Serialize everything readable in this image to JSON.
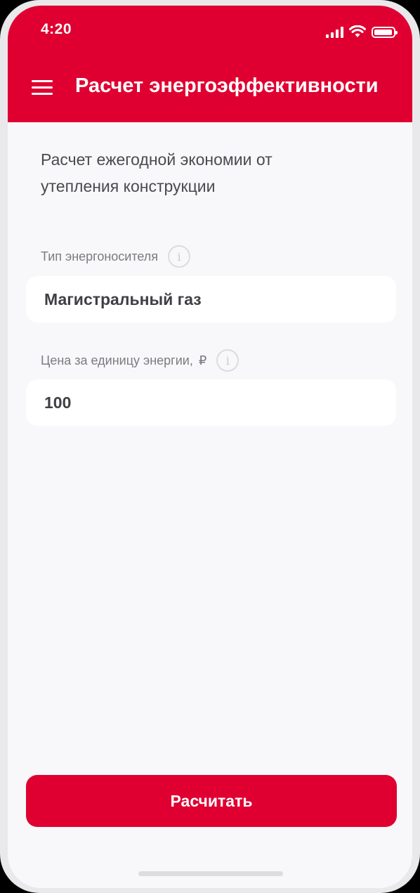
{
  "status_bar": {
    "time": "4:20"
  },
  "header": {
    "title": "Расчет энергоэффективности",
    "menu_icon": "hamburger-menu-icon",
    "accent_color": "#df0031"
  },
  "main": {
    "section_title": "Расчет ежегодной экономии от утепления конструкции",
    "fields": [
      {
        "label": "Тип энергоносителя",
        "value": "Магистральный газ",
        "info_icon": "info-icon"
      },
      {
        "label": "Цена за единицу энергии,",
        "unit": "₽",
        "value": "100",
        "info_icon": "info-icon"
      }
    ],
    "info_glyph": "i"
  },
  "footer": {
    "calculate_label": "Расчитать"
  }
}
